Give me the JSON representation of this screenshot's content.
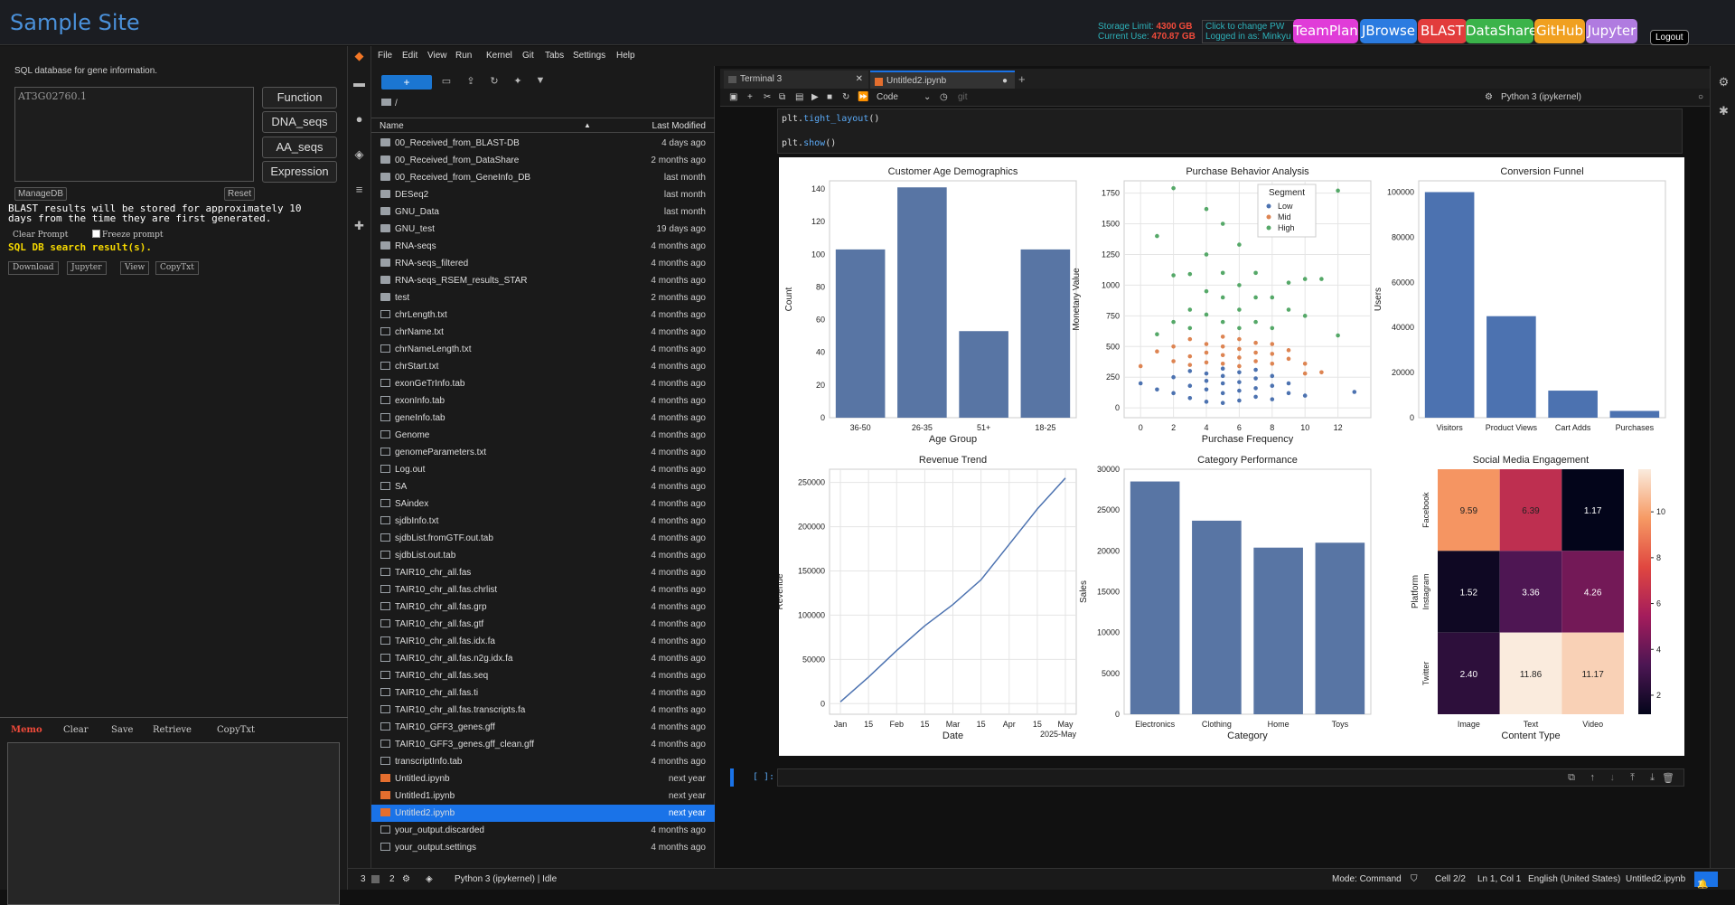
{
  "topbar": {
    "site_title": "Sample Site",
    "storage_limit_label": "Storage Limit:",
    "storage_limit_value": "4300 GB",
    "current_use_label": "Current Use:",
    "current_use_value": "470.87 GB",
    "pw_line1": "Click to change PW",
    "pw_line2": "Logged in as: Minkyu",
    "nav": [
      {
        "label": "TeamPlan",
        "color": "#e03cd8"
      },
      {
        "label": "JBrowse",
        "color": "#2b7be0"
      },
      {
        "label": "BLAST",
        "color": "#e23c3c"
      },
      {
        "label": "DataShare",
        "color": "#3bb34a"
      },
      {
        "label": "GitHub",
        "color": "#f0a020"
      },
      {
        "label": "Jupyter",
        "color": "#b07be0"
      }
    ],
    "logout": "Logout"
  },
  "left": {
    "sql_description": "SQL database for gene information.",
    "sql_value": "AT3G02760.1",
    "buttons": [
      "Function",
      "DNA_seqs",
      "AA_seqs",
      "Expression"
    ],
    "manage_db": "ManageDB",
    "reset": "Reset",
    "clear_prompt": "Clear Prompt",
    "freeze_prompt": "Freeze prompt",
    "search_result": "SQL DB search result(s).",
    "actions": [
      "Download",
      "Jupyter",
      "View",
      "CopyTxt"
    ],
    "blast_note_1": "BLAST results will be stored for approximately 10",
    "blast_note_2": "days from the time they are first generated.",
    "memo": {
      "title": "Memo",
      "clear": "Clear",
      "save": "Save",
      "retrieve": "Retrieve",
      "copy": "CopyTxt"
    }
  },
  "menu": [
    "File",
    "Edit",
    "View",
    "Run",
    "Kernel",
    "Git",
    "Tabs",
    "Settings",
    "Help"
  ],
  "filebrowser": {
    "new_label": "+",
    "breadcrumb": "/",
    "col_name": "Name",
    "col_modified": "Last Modified",
    "files": [
      {
        "name": "00_Received_from_BLAST-DB",
        "modified": "4 days ago",
        "type": "folder"
      },
      {
        "name": "00_Received_from_DataShare",
        "modified": "2 months ago",
        "type": "folder"
      },
      {
        "name": "00_Received_from_GeneInfo_DB",
        "modified": "last month",
        "type": "folder"
      },
      {
        "name": "DESeq2",
        "modified": "last month",
        "type": "folder"
      },
      {
        "name": "GNU_Data",
        "modified": "last month",
        "type": "folder"
      },
      {
        "name": "GNU_test",
        "modified": "19 days ago",
        "type": "folder"
      },
      {
        "name": "RNA-seqs",
        "modified": "4 months ago",
        "type": "folder"
      },
      {
        "name": "RNA-seqs_filtered",
        "modified": "4 months ago",
        "type": "folder"
      },
      {
        "name": "RNA-seqs_RSEM_results_STAR",
        "modified": "4 months ago",
        "type": "folder"
      },
      {
        "name": "test",
        "modified": "2 months ago",
        "type": "folder"
      },
      {
        "name": "chrLength.txt",
        "modified": "4 months ago",
        "type": "file"
      },
      {
        "name": "chrName.txt",
        "modified": "4 months ago",
        "type": "file"
      },
      {
        "name": "chrNameLength.txt",
        "modified": "4 months ago",
        "type": "file"
      },
      {
        "name": "chrStart.txt",
        "modified": "4 months ago",
        "type": "file"
      },
      {
        "name": "exonGeTrInfo.tab",
        "modified": "4 months ago",
        "type": "file"
      },
      {
        "name": "exonInfo.tab",
        "modified": "4 months ago",
        "type": "file"
      },
      {
        "name": "geneInfo.tab",
        "modified": "4 months ago",
        "type": "file"
      },
      {
        "name": "Genome",
        "modified": "4 months ago",
        "type": "file"
      },
      {
        "name": "genomeParameters.txt",
        "modified": "4 months ago",
        "type": "file"
      },
      {
        "name": "Log.out",
        "modified": "4 months ago",
        "type": "file"
      },
      {
        "name": "SA",
        "modified": "4 months ago",
        "type": "file"
      },
      {
        "name": "SAindex",
        "modified": "4 months ago",
        "type": "file"
      },
      {
        "name": "sjdbInfo.txt",
        "modified": "4 months ago",
        "type": "file"
      },
      {
        "name": "sjdbList.fromGTF.out.tab",
        "modified": "4 months ago",
        "type": "file"
      },
      {
        "name": "sjdbList.out.tab",
        "modified": "4 months ago",
        "type": "file"
      },
      {
        "name": "TAIR10_chr_all.fas",
        "modified": "4 months ago",
        "type": "file"
      },
      {
        "name": "TAIR10_chr_all.fas.chrlist",
        "modified": "4 months ago",
        "type": "file"
      },
      {
        "name": "TAIR10_chr_all.fas.grp",
        "modified": "4 months ago",
        "type": "file"
      },
      {
        "name": "TAIR10_chr_all.fas.gtf",
        "modified": "4 months ago",
        "type": "file"
      },
      {
        "name": "TAIR10_chr_all.fas.idx.fa",
        "modified": "4 months ago",
        "type": "file"
      },
      {
        "name": "TAIR10_chr_all.fas.n2g.idx.fa",
        "modified": "4 months ago",
        "type": "file"
      },
      {
        "name": "TAIR10_chr_all.fas.seq",
        "modified": "4 months ago",
        "type": "file"
      },
      {
        "name": "TAIR10_chr_all.fas.ti",
        "modified": "4 months ago",
        "type": "file"
      },
      {
        "name": "TAIR10_chr_all.fas.transcripts.fa",
        "modified": "4 months ago",
        "type": "file"
      },
      {
        "name": "TAIR10_GFF3_genes.gff",
        "modified": "4 months ago",
        "type": "file"
      },
      {
        "name": "TAIR10_GFF3_genes.gff_clean.gff",
        "modified": "4 months ago",
        "type": "file"
      },
      {
        "name": "transcriptInfo.tab",
        "modified": "4 months ago",
        "type": "file"
      },
      {
        "name": "Untitled.ipynb",
        "modified": "next year",
        "type": "notebook"
      },
      {
        "name": "Untitled1.ipynb",
        "modified": "next year",
        "type": "notebook"
      },
      {
        "name": "Untitled2.ipynb",
        "modified": "next year",
        "type": "notebook",
        "selected": true
      },
      {
        "name": "your_output.discarded",
        "modified": "4 months ago",
        "type": "file"
      },
      {
        "name": "your_output.settings",
        "modified": "4 months ago",
        "type": "file"
      }
    ]
  },
  "tabs": [
    {
      "label": "Terminal 3"
    },
    {
      "label": "Untitled2.ipynb"
    }
  ],
  "notebook": {
    "celltype": "Code",
    "kernel": "Python 3 (ipykernel)",
    "code_line1_prefix": "plt.",
    "code_line1_fn": "tight_layout",
    "code_line1_suffix": "()",
    "code_line2_prefix": "plt.",
    "code_line2_fn": "show",
    "code_line2_suffix": "()",
    "empty_prompt": "[ ]:"
  },
  "status": {
    "left1": "3",
    "left2": "2",
    "kernel": "Python 3 (ipykernel) | Idle",
    "mode": "Mode: Command",
    "cell": "Cell 2/2",
    "ln": "Ln 1, Col 1",
    "lang": "English (United States)",
    "file": "Untitled2.ipynb",
    "notif": "1"
  },
  "chart_data": [
    {
      "type": "bar",
      "title": "Customer Age Demographics",
      "xlabel": "Age Group",
      "ylabel": "Count",
      "categories": [
        "36-50",
        "26-35",
        "51+",
        "18-25"
      ],
      "values": [
        103,
        141,
        53,
        103
      ],
      "ylim": [
        0,
        145
      ],
      "yticks": [
        0,
        20,
        40,
        60,
        80,
        100,
        120,
        140
      ],
      "color": "#5875a4"
    },
    {
      "type": "scatter",
      "title": "Purchase Behavior Analysis",
      "xlabel": "Purchase Frequency",
      "ylabel": "Monetary Value",
      "xlim": [
        -1,
        14
      ],
      "ylim": [
        -80,
        1850
      ],
      "xticks": [
        0,
        2,
        4,
        6,
        8,
        10,
        12
      ],
      "yticks": [
        0,
        250,
        500,
        750,
        1000,
        1250,
        1500,
        1750
      ],
      "legend_title": "Segment",
      "legend_position": "top",
      "series": [
        {
          "name": "Low",
          "color": "#4c72b0",
          "points": [
            [
              0,
              200
            ],
            [
              1,
              150
            ],
            [
              2,
              120
            ],
            [
              2,
              250
            ],
            [
              3,
              80
            ],
            [
              3,
              180
            ],
            [
              3,
              300
            ],
            [
              4,
              50
            ],
            [
              4,
              150
            ],
            [
              4,
              220
            ],
            [
              4,
              280
            ],
            [
              5,
              40
            ],
            [
              5,
              120
            ],
            [
              5,
              200
            ],
            [
              5,
              260
            ],
            [
              5,
              320
            ],
            [
              6,
              60
            ],
            [
              6,
              140
            ],
            [
              6,
              210
            ],
            [
              6,
              290
            ],
            [
              7,
              90
            ],
            [
              7,
              160
            ],
            [
              7,
              240
            ],
            [
              7,
              310
            ],
            [
              8,
              70
            ],
            [
              8,
              180
            ],
            [
              8,
              260
            ],
            [
              9,
              120
            ],
            [
              9,
              200
            ],
            [
              10,
              100
            ],
            [
              13,
              130
            ]
          ]
        },
        {
          "name": "Mid",
          "color": "#dd8452",
          "points": [
            [
              0,
              340
            ],
            [
              1,
              460
            ],
            [
              2,
              380
            ],
            [
              2,
              500
            ],
            [
              3,
              350
            ],
            [
              3,
              420
            ],
            [
              3,
              560
            ],
            [
              4,
              370
            ],
            [
              4,
              450
            ],
            [
              4,
              520
            ],
            [
              5,
              360
            ],
            [
              5,
              430
            ],
            [
              5,
              500
            ],
            [
              5,
              580
            ],
            [
              6,
              340
            ],
            [
              6,
              410
            ],
            [
              6,
              480
            ],
            [
              6,
              560
            ],
            [
              7,
              380
            ],
            [
              7,
              450
            ],
            [
              7,
              530
            ],
            [
              8,
              360
            ],
            [
              8,
              440
            ],
            [
              8,
              520
            ],
            [
              9,
              400
            ],
            [
              9,
              470
            ],
            [
              10,
              360
            ],
            [
              11,
              290
            ],
            [
              10,
              280
            ]
          ]
        },
        {
          "name": "High",
          "color": "#55a868",
          "points": [
            [
              1,
              1400
            ],
            [
              1,
              600
            ],
            [
              2,
              1790
            ],
            [
              2,
              1080
            ],
            [
              2,
              700
            ],
            [
              3,
              1090
            ],
            [
              3,
              800
            ],
            [
              3,
              650
            ],
            [
              4,
              1250
            ],
            [
              4,
              950
            ],
            [
              4,
              760
            ],
            [
              4,
              1620
            ],
            [
              5,
              1100
            ],
            [
              5,
              900
            ],
            [
              5,
              700
            ],
            [
              5,
              1500
            ],
            [
              6,
              1330
            ],
            [
              6,
              1000
            ],
            [
              6,
              800
            ],
            [
              6,
              650
            ],
            [
              7,
              1100
            ],
            [
              7,
              900
            ],
            [
              7,
              700
            ],
            [
              8,
              900
            ],
            [
              8,
              650
            ],
            [
              9,
              1020
            ],
            [
              9,
              800
            ],
            [
              10,
              1050
            ],
            [
              10,
              750
            ],
            [
              11,
              1050
            ],
            [
              12,
              1770
            ],
            [
              12,
              590
            ]
          ]
        }
      ]
    },
    {
      "type": "bar",
      "title": "Conversion Funnel",
      "xlabel": "",
      "ylabel": "Users",
      "categories": [
        "Visitors",
        "Product Views",
        "Cart Adds",
        "Purchases"
      ],
      "values": [
        100000,
        45000,
        12000,
        3000
      ],
      "ylim": [
        0,
        105000
      ],
      "yticks": [
        0,
        20000,
        40000,
        60000,
        80000,
        100000
      ],
      "color": "#4c72b0"
    },
    {
      "type": "line",
      "title": "Revenue Trend",
      "xlabel": "Date",
      "ylabel": "Revenue",
      "x_ticklabels": [
        "Jan",
        "15",
        "Feb",
        "15",
        "Mar",
        "15",
        "Apr",
        "15",
        "May"
      ],
      "x_offset_label": "2025-May",
      "ylim": [
        -12000,
        265000
      ],
      "yticks": [
        0,
        50000,
        100000,
        150000,
        200000,
        250000
      ],
      "x": [
        "2025-01-01",
        "2025-01-15",
        "2025-02-01",
        "2025-02-15",
        "2025-03-01",
        "2025-03-15",
        "2025-04-01",
        "2025-04-15",
        "2025-05-01"
      ],
      "values": [
        2000,
        30000,
        60000,
        88000,
        112000,
        140000,
        180000,
        220000,
        255000
      ],
      "color": "#4c72b0"
    },
    {
      "type": "bar",
      "title": "Category Performance",
      "xlabel": "Category",
      "ylabel": "Sales",
      "categories": [
        "Electronics",
        "Clothing",
        "Home",
        "Toys"
      ],
      "values": [
        28500,
        23700,
        20400,
        21000
      ],
      "ylim": [
        0,
        30000
      ],
      "yticks": [
        0,
        5000,
        10000,
        15000,
        20000,
        25000,
        30000
      ],
      "color": "#5875a4"
    },
    {
      "type": "heatmap",
      "title": "Social Media Engagement",
      "xlabel": "Content Type",
      "ylabel": "Platform",
      "x_categories": [
        "Image",
        "Text",
        "Video"
      ],
      "y_categories": [
        "Facebook",
        "Instagram",
        "Twitter"
      ],
      "values": [
        [
          9.59,
          6.39,
          1.17
        ],
        [
          1.52,
          3.36,
          4.26
        ],
        [
          2.4,
          11.86,
          11.17
        ]
      ],
      "colorbar_ticks": [
        2,
        4,
        6,
        8,
        10
      ]
    }
  ]
}
